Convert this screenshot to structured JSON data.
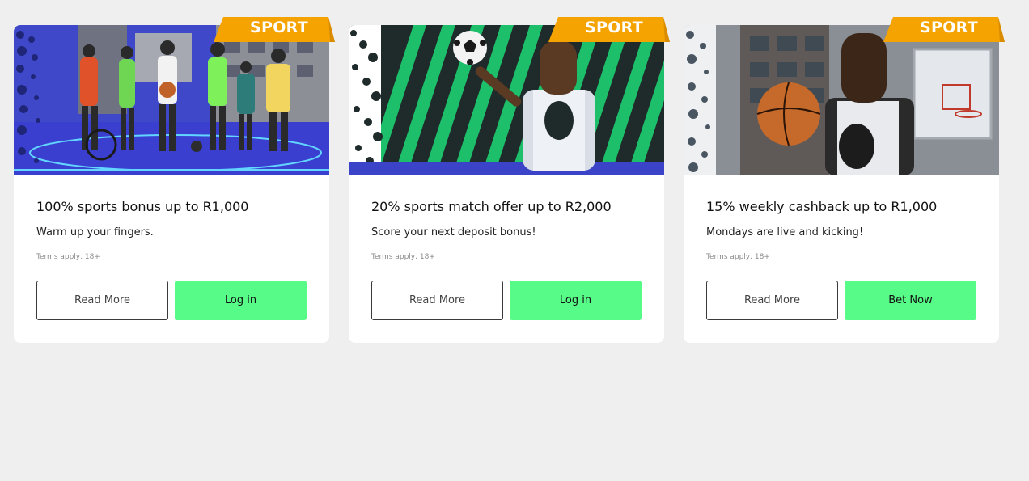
{
  "cards": [
    {
      "badge": "SPORT",
      "title": "100% sports bonus up to R1,000",
      "subtitle": "Warm up your fingers.",
      "terms": "Terms apply, 18+",
      "secondary_label": "Read More",
      "primary_label": "Log in",
      "image_alt": "Group of athletes on a blue sports court"
    },
    {
      "badge": "SPORT",
      "title": "20% sports match offer up to R2,000",
      "subtitle": "Score your next deposit bonus!",
      "terms": "Terms apply, 18+",
      "secondary_label": "Read More",
      "primary_label": "Log in",
      "image_alt": "Player in 10BET vest with a football on green striped background"
    },
    {
      "badge": "SPORT",
      "title": "15% weekly cashback up to R1,000",
      "subtitle": "Mondays are live and kicking!",
      "terms": "Terms apply, 18+",
      "secondary_label": "Read More",
      "primary_label": "Bet Now",
      "image_alt": "Basketball player holding a ball on an outdoor court"
    }
  ],
  "colors": {
    "background": "#efefef",
    "card": "#ffffff",
    "badge": "#f5a300",
    "primary_button": "#57fb87",
    "outline": "#3a3a3a"
  }
}
